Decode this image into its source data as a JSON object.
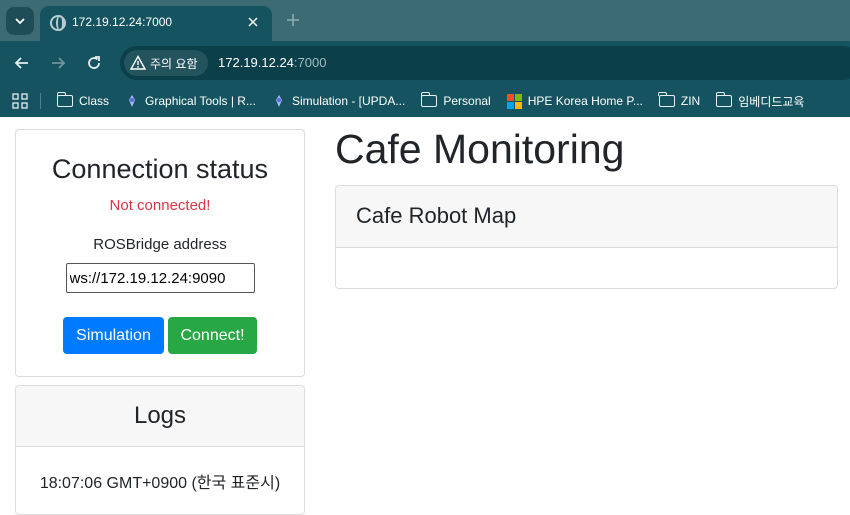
{
  "browser": {
    "tab": {
      "title": "172.19.12.24:7000"
    },
    "address": {
      "security_label": "주의 요함",
      "host": "172.19.12.24",
      "port": ":7000"
    },
    "bookmarks": [
      {
        "label": "Class",
        "icon": "folder-icon"
      },
      {
        "label": "Graphical Tools | R...",
        "icon": "ros-icon"
      },
      {
        "label": "Simulation - [UPDA...",
        "icon": "ros-icon"
      },
      {
        "label": "Personal",
        "icon": "folder-icon"
      },
      {
        "label": "HPE Korea Home P...",
        "icon": "microsoft-icon"
      },
      {
        "label": "ZIN",
        "icon": "folder-icon"
      },
      {
        "label": "임베디드교육",
        "icon": "folder-icon"
      }
    ]
  },
  "connection": {
    "title": "Connection status",
    "status": "Not connected!",
    "address_label": "ROSBridge address",
    "address_value": "ws://172.19.12.24:9090",
    "simulation_button": "Simulation",
    "connect_button": "Connect!"
  },
  "logs": {
    "title": "Logs",
    "entries": [
      "18:07:06 GMT+0900 (한국 표준시)"
    ]
  },
  "main": {
    "title": "Cafe Monitoring",
    "map_card_title": "Cafe Robot Map"
  },
  "colors": {
    "status_error": "#dc3545",
    "primary": "#007bff",
    "success": "#28a745",
    "chrome": "#14535f"
  }
}
